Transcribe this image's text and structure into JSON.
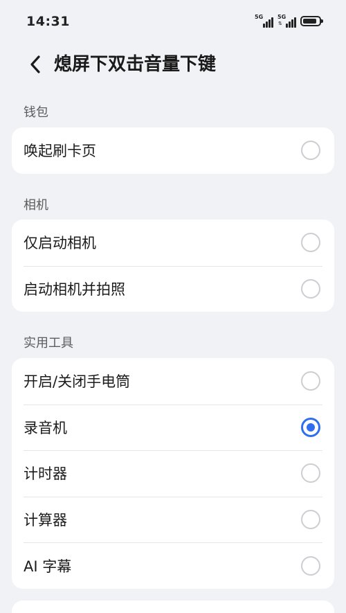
{
  "status_bar": {
    "time": "14:31",
    "sim1_network": "5G",
    "sim2_network": "5G",
    "icons": [
      "signal-icon",
      "signal-icon",
      "battery-icon"
    ]
  },
  "header": {
    "back_icon": "chevron-left-icon",
    "title": "熄屏下双击音量下键"
  },
  "accent_color": "#2f6ef0",
  "sections": [
    {
      "label": "钱包",
      "options": [
        {
          "label": "唤起刷卡页",
          "selected": false
        }
      ]
    },
    {
      "label": "相机",
      "options": [
        {
          "label": "仅启动相机",
          "selected": false
        },
        {
          "label": "启动相机并拍照",
          "selected": false
        }
      ]
    },
    {
      "label": "实用工具",
      "options": [
        {
          "label": "开启/关闭手电筒",
          "selected": false
        },
        {
          "label": "录音机",
          "selected": true
        },
        {
          "label": "计时器",
          "selected": false
        },
        {
          "label": "计算器",
          "selected": false
        },
        {
          "label": "AI 字幕",
          "selected": false
        }
      ]
    }
  ]
}
